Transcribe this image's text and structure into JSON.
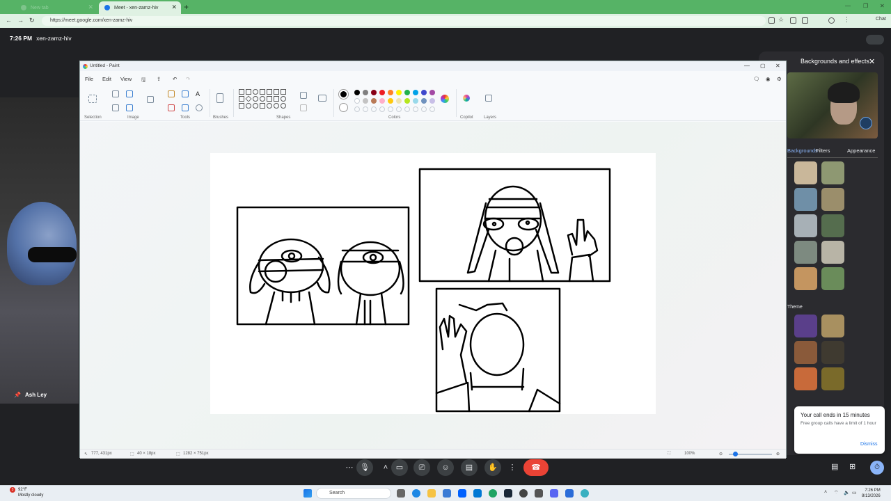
{
  "browser": {
    "tabs": [
      {
        "title": "New tab"
      },
      {
        "title": "Meet - xen-zamz-hiv"
      }
    ],
    "new_tab": "+",
    "url": "https://meet.google.com/xen-zamz-hiv",
    "chat_label": "Chat"
  },
  "meet": {
    "time": "7:26 PM",
    "meeting_code": "xen-zamz-hiv",
    "participant_name": "Ash Ley",
    "effects_panel": {
      "title": "Backgrounds and effects",
      "tabs": [
        "Backgrounds",
        "Filters",
        "Appearance"
      ],
      "section_label": "Theme"
    },
    "toast": {
      "title": "Your call ends in 15 minutes",
      "body": "Free group calls have a limit of 1 hour",
      "dismiss": "Dismiss"
    }
  },
  "paint": {
    "title": "Untitled - Paint",
    "menus": [
      "File",
      "Edit",
      "View"
    ],
    "groups": [
      "Selection",
      "Image",
      "Tools",
      "Brushes",
      "Shapes",
      "Colors",
      "Copilot",
      "Layers"
    ],
    "palette": [
      "#000000",
      "#7f7f7f",
      "#880015",
      "#ed1c24",
      "#ff7f27",
      "#fff200",
      "#22b14c",
      "#00a2e8",
      "#3f48cc",
      "#a349a4"
    ],
    "palette_row2": [
      "#ffffff",
      "#c3c3c3",
      "#b97a57",
      "#ffaec9",
      "#ffc90e",
      "#efe4b0",
      "#b5e61d",
      "#99d9ea",
      "#7092be",
      "#c8bfe7"
    ],
    "status": {
      "cursor": "777, 431px",
      "selection": "40 × 18px",
      "canvas_size": "1282 × 751px",
      "zoom": "100%"
    }
  },
  "taskbar": {
    "weather_temp": "92°F",
    "weather_desc": "Mostly cloudy",
    "weather_badge": "3",
    "search": "Search",
    "time": "7:26 PM",
    "date": "8/13/2026"
  }
}
